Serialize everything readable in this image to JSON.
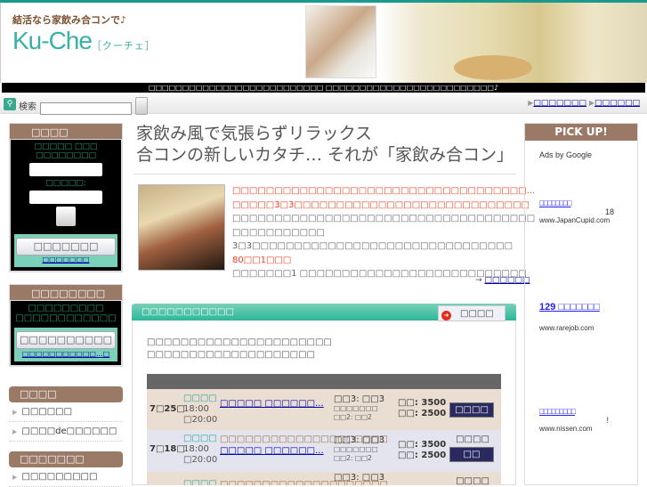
{
  "header": {
    "tagline": "結活なら家飲み合コンで♪",
    "logo": "Ku-Che",
    "logo_sub": "［クーチェ］",
    "banner_text": "□□□□□□□□□□□□□□□□□□□□□□□□□□ □□□□□□□□□□□□□□□□□□□□□□□□□♪"
  },
  "search": {
    "label": "検索",
    "value": "",
    "button_label": ""
  },
  "top_links": [
    "□□□□□□□",
    "□□□□□□"
  ],
  "login": {
    "title": "□□□□",
    "prompt_line1": "□□□□□ □□□",
    "prompt_line2": "□□□□□□□□",
    "password_label": "□□□□□:",
    "register_button": "□□□□□□□",
    "link": "□□□□□□□"
  },
  "signup": {
    "title": "□□□□□□□□",
    "line1": "□□□□□□□□□",
    "line2": "□□□□□□□□□□□□",
    "button": "□□□□□□□□□□",
    "link": "□□□□□□□□□□□...□"
  },
  "menus": [
    {
      "title": "□□□□",
      "items": [
        "□□□□□□",
        "□□□□de□□□□□□"
      ]
    },
    {
      "title": "□□□□□□□",
      "items": [
        "□□□□□□□□□"
      ]
    }
  ],
  "main": {
    "headline1": "家飲み風で気張らずリラックス",
    "headline2": "合コンの新しいカタチ… それが「家飲み合コン」",
    "intro": [
      {
        "text": "□□□□□□□□□□□□□□□□□□□□□□□□□□□□□□□□□□□...",
        "red": true
      },
      {
        "text": "□□□□□3□3□□□□□□□□□□□□□□□□□□□□□□□□□□□□",
        "red": true
      },
      {
        "text": "□□□□□□□□□□□□□□□□□□□□□□□□□□□□□□□□□□□□",
        "red": false
      },
      {
        "text": "□□□□□□□□□□□",
        "red": false
      },
      {
        "text": "3□3□□□□□□□□□□□□□□□□□□□□□□□□□□□□□□□",
        "red": false
      },
      {
        "text": "80□□1□□□",
        "red": true
      },
      {
        "text": "□□□□□□□1 □□□□□□□□□□□□□□□□□□□□□□□□□□□",
        "red": false
      }
    ],
    "more_link": "□□□□□□",
    "section_title": "□□□□□□□□□□□",
    "list_button": "□□□□",
    "section_desc1": "□□□□□□□□□□□□□□□□□□□□□□",
    "section_desc2": "□□□□□□□□□□□□□□□□□□□□",
    "events": [
      {
        "date": "7□25□",
        "status": "□□□□",
        "start": "18:00",
        "end": "□20:00",
        "org": "",
        "title": "□□□□□ □□□□□□...",
        "ratio": "□□3: □□3",
        "ratio_sub1": "□□□□□□□",
        "ratio_sub2": "□□2: □□2",
        "price_m": "□□: 3500",
        "price_f": "□□: 2500",
        "state": "",
        "button": "□□□□"
      },
      {
        "date": "7□18□",
        "status": "□□□□",
        "start": "18:00",
        "end": "□20:00",
        "org": "□□□□□□□□□□□□□□□□□□□□",
        "title": "□□□□□ □□□□□□...",
        "ratio": "□□3: □□3",
        "ratio_sub1": "□□□□□□□",
        "ratio_sub2": "□□2: □□2",
        "price_m": "□□: 3500",
        "price_f": "□□: 2500",
        "state": "□□□□",
        "button": "□□"
      },
      {
        "date": "",
        "status": "□□□□",
        "start": "",
        "end": "",
        "org": "□□□□□□□□□□□□□□□□□□□□",
        "title": "",
        "ratio": "□□3: □□3",
        "ratio_sub1": "",
        "ratio_sub2": "",
        "price_m": "",
        "price_f": "",
        "state": "□□□□",
        "button": ""
      }
    ]
  },
  "pickup": {
    "title": "PICK UP!",
    "ads_label": "Ads by Google",
    "ads": [
      {
        "title": "□□□□□□□□",
        "desc": "18",
        "url": "www.JapanCupid.com"
      },
      {
        "title": "129 □□□□□□□",
        "desc": "",
        "url": "www.rarejob.com"
      },
      {
        "title": "□□□□□□□□□",
        "desc": "!",
        "url": "www.nissen.com"
      }
    ]
  }
}
